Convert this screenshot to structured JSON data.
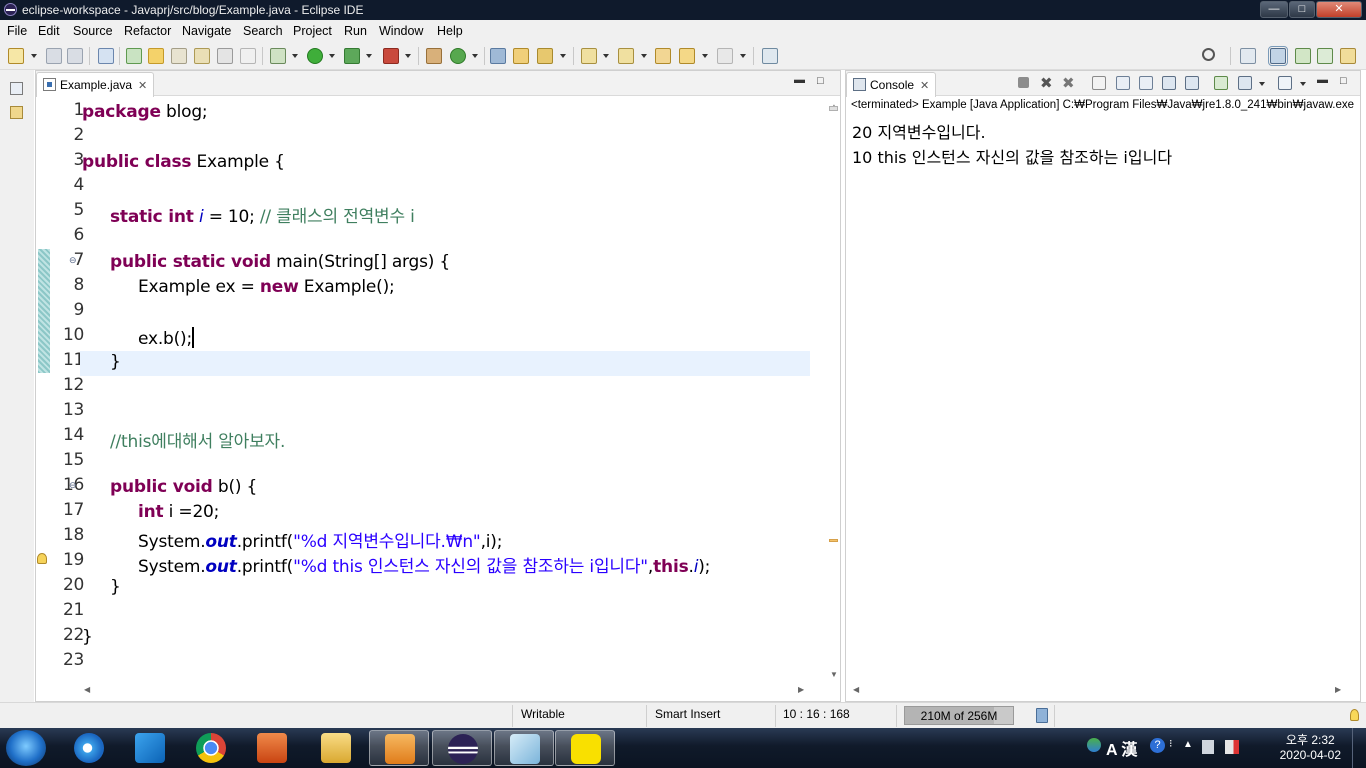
{
  "window": {
    "title": "eclipse-workspace - Javaprj/src/blog/Example.java - Eclipse IDE",
    "min": "—",
    "max": "□",
    "close": "✕"
  },
  "menu": [
    "File",
    "Edit",
    "Source",
    "Refactor",
    "Navigate",
    "Search",
    "Project",
    "Run",
    "Window",
    "Help"
  ],
  "editor": {
    "tab_label": "Example.java",
    "tab_close": "✕",
    "lines": [
      "1",
      "2",
      "3",
      "4",
      "5",
      "6",
      "7",
      "8",
      "9",
      "10",
      "11",
      "12",
      "13",
      "14",
      "15",
      "16",
      "17",
      "18",
      "19",
      "20",
      "21",
      "22",
      "23"
    ],
    "code": {
      "l1_kw": "package",
      "l1_rest": " blog;",
      "l3_kw": "public class",
      "l3_rest": " Example {",
      "l5_kw": "static int",
      "l5_sp": " ",
      "l5_field": "i",
      "l5_rest": " = 10; ",
      "l5_comment": "// 클래스의 전역변수 i",
      "l7_kw": "public static void",
      "l7_rest": " main(String[] args) {",
      "l8_a": "Example ex = ",
      "l8_kw": "new",
      "l8_b": " Example();",
      "l10": "ex.b();",
      "l11": "}",
      "l14_comment": "//this에대해서 알아보자.",
      "l16_kw": "public void",
      "l16_rest": " b() {",
      "l17_kw": "int",
      "l17_rest": " i =20;",
      "l18_a": "System.",
      "l18_out": "out",
      "l18_b": ".printf(",
      "l18_str": "\"%d 지역변수입니다.₩n\"",
      "l18_c": ",i);",
      "l19_a": "System.",
      "l19_out": "out",
      "l19_b": ".printf(",
      "l19_str": "\"%d this 인스턴스 자신의 값을 참조하는 i입니다\"",
      "l19_c": ",",
      "l19_this": "this",
      "l19_dot": ".",
      "l19_i": "i",
      "l19_end": ");",
      "l20": "}",
      "l22": "}"
    }
  },
  "console": {
    "tab_label": "Console",
    "tab_close": "✕",
    "header": "<terminated> Example [Java Application] C:₩Program Files₩Java₩jre1.8.0_241₩bin₩javaw.exe",
    "output": [
      "20 지역변수입니다.",
      "10 this 인스턴스 자신의 값을 참조하는 i입니다"
    ]
  },
  "status": {
    "writable": "Writable",
    "insert_mode": "Smart Insert",
    "position": "10 : 16 : 168",
    "heap": "210M of 256M",
    "heap_used_fraction": 0.82
  },
  "taskbar": {
    "apps": [
      "internet-explorer",
      "visual-studio-code",
      "chrome",
      "powerpoint",
      "file-explorer",
      "media-player",
      "eclipse",
      "notepad",
      "kakaotalk"
    ],
    "ime": "A 漢",
    "clock_time": "오후 2:32",
    "clock_date": "2020-04-02"
  }
}
